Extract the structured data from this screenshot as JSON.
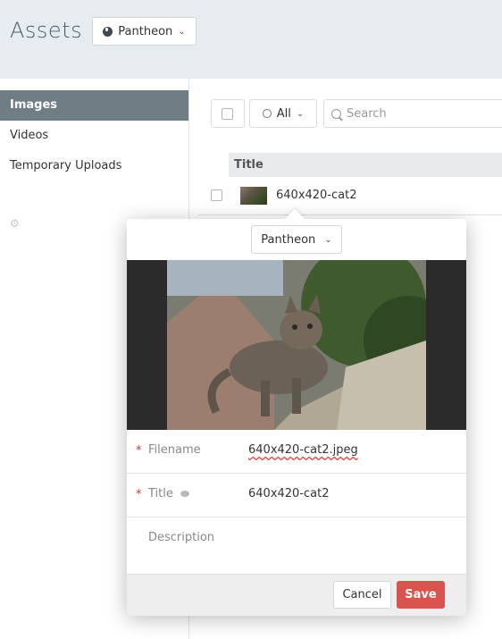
{
  "header": {
    "title": "Assets",
    "site_selector": {
      "label": "Pantheon",
      "icon": "globe-icon"
    }
  },
  "sidebar": {
    "items": [
      {
        "label": "Images",
        "active": true
      },
      {
        "label": "Videos",
        "active": false
      },
      {
        "label": "Temporary Uploads",
        "active": false
      }
    ],
    "settings_icon": "gear-icon"
  },
  "toolbar": {
    "filter_label": "All",
    "search_placeholder": "Search"
  },
  "table": {
    "columns": [
      "Title"
    ],
    "rows": [
      {
        "title": "640x420-cat2"
      }
    ]
  },
  "popover": {
    "site_label": "Pantheon",
    "image_alt": "640x420-cat2",
    "fields": {
      "filename": {
        "label": "Filename",
        "value": "640x420-cat2.jpeg",
        "required": "*"
      },
      "title": {
        "label": "Title",
        "value": "640x420-cat2",
        "required": "*"
      },
      "description": {
        "label": "Description",
        "value": ""
      }
    },
    "actions": {
      "cancel": "Cancel",
      "save": "Save"
    }
  },
  "colors": {
    "header_bg": "#e6ecef",
    "sidebar_active": "#6f7d84",
    "save_button": "#d9534f",
    "required_marker": "#c0392b"
  }
}
